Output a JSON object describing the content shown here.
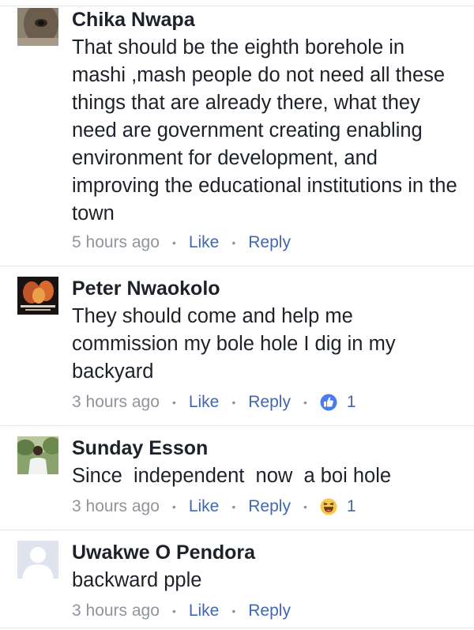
{
  "comments": [
    {
      "name": "Chika Nwapa",
      "text": "That should be the eighth borehole in mashi ,mash people do not need all these things that are already there, what they need are government creating enabling environment for development, and improving the educational institutions in the town",
      "time": "5 hours ago",
      "like_label": "Like",
      "reply_label": "Reply"
    },
    {
      "name": "Peter Nwaokolo",
      "text": "They should come and help me commission my bole hole I dig in my backyard",
      "time": "3 hours ago",
      "like_label": "Like",
      "reply_label": "Reply",
      "reaction_icon": "like-thumb-icon",
      "reaction_count": "1"
    },
    {
      "name": "Sunday Esson",
      "text": "Since  independent  now  a boi hole",
      "time": "3 hours ago",
      "like_label": "Like",
      "reply_label": "Reply",
      "reaction_icon": "haha-emoji-icon",
      "reaction_count": "1"
    },
    {
      "name": "Uwakwe O Pendora",
      "text": "backward pple",
      "time": "3 hours ago",
      "like_label": "Like",
      "reply_label": "Reply"
    }
  ],
  "colors": {
    "link": "#4267b2",
    "meta_gray": "#90949c",
    "text": "#1d2129",
    "separator": "#e5e6e9"
  }
}
